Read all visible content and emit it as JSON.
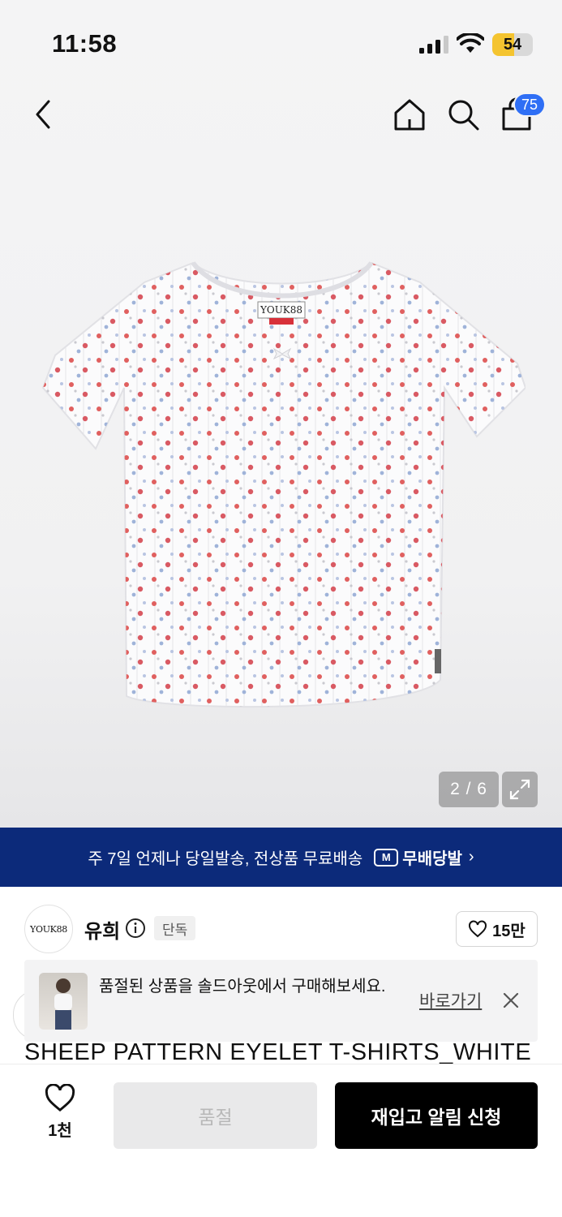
{
  "status_bar": {
    "time": "11:58",
    "battery": "54"
  },
  "nav": {
    "cart_count": "75"
  },
  "product_image": {
    "brand_label": "YOUK88",
    "page_indicator": "2 / 6"
  },
  "shipping_banner": {
    "text": "주 7일 언제나 당일발송, 전상품 무료배송",
    "logo_mark": "M",
    "logo_text": "무배당발",
    "arrow": "›"
  },
  "brand": {
    "logo_text": "YOUK88",
    "name": "유희",
    "tag": "단독",
    "likes": "15만"
  },
  "soldout_notice": {
    "text": "품절된 상품을 솔드아웃에서 구매해보세요.",
    "link": "바로가기"
  },
  "product": {
    "title": "SHEEP PATTERN EYELET T-SHIRTS_WHITE"
  },
  "bottom_bar": {
    "wish_count": "1천",
    "soldout_label": "품절",
    "restock_label": "재입고 알림 신청"
  },
  "colors": {
    "banner": "#0c2a7a",
    "badge": "#2f6ff5",
    "battery": "#f4c430",
    "primary_button": "#000000"
  }
}
